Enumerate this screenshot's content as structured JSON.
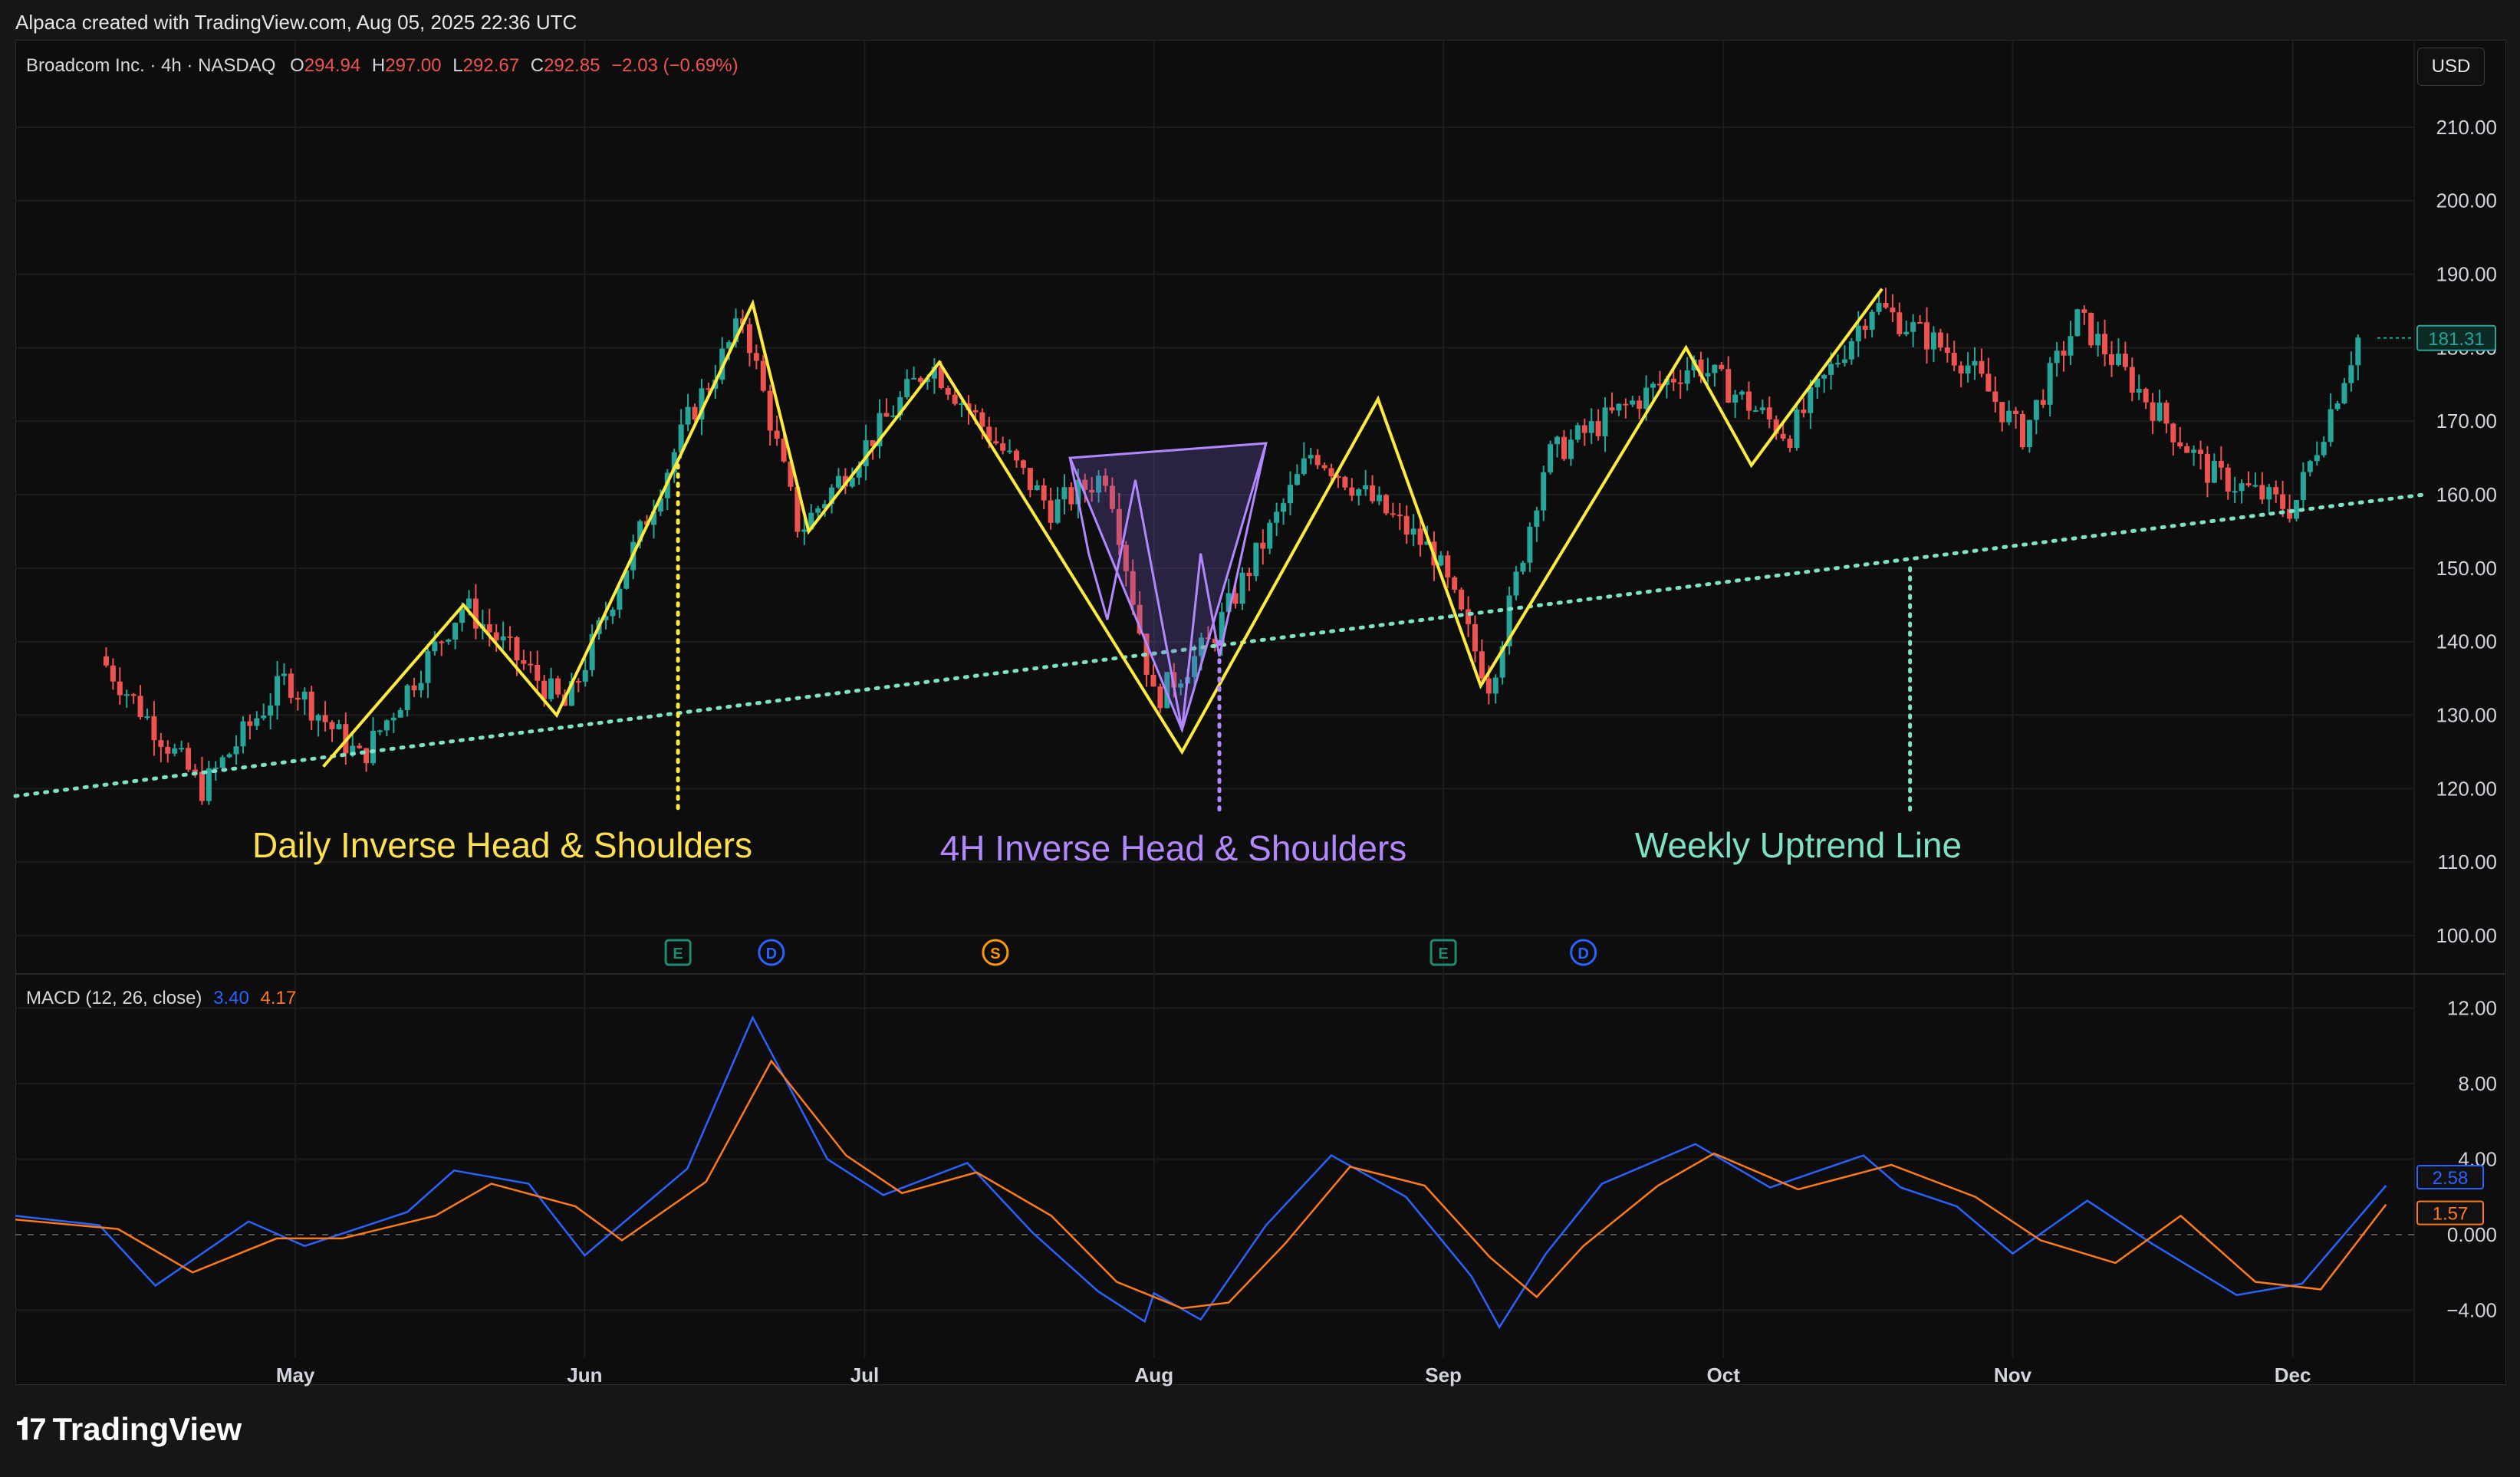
{
  "header": {
    "created_by": "Alpaca created with TradingView.com, Aug 05, 2025 22:36 UTC"
  },
  "legend": {
    "symbol": "Broadcom Inc. · 4h · NASDAQ",
    "o_label": "O",
    "o_value": "294.94",
    "h_label": "H",
    "h_value": "297.00",
    "l_label": "L",
    "l_value": "292.67",
    "c_label": "C",
    "c_value": "292.85",
    "change": "−2.03 (−0.69%)"
  },
  "currency_button": "USD",
  "macd_legend": {
    "label": "MACD (12, 26, close)",
    "macd_value": "3.40",
    "signal_value": "4.17"
  },
  "annotations": {
    "daily": "Daily Inverse Head & Shoulders",
    "fourh": "4H Inverse Head & Shoulders",
    "weekly": "Weekly Uptrend Line"
  },
  "event_markers": [
    {
      "letter": "E",
      "color": "#1f8a70"
    },
    {
      "letter": "D",
      "color": "#2962ff"
    },
    {
      "letter": "S",
      "color": "#ff9800"
    },
    {
      "letter": "E",
      "color": "#1f8a70"
    },
    {
      "letter": "D",
      "color": "#2962ff"
    }
  ],
  "brand": "TradingView",
  "colors": {
    "up": "#26a69a",
    "down": "#ef5350",
    "macd": "#2962ff",
    "signal": "#ff7a1a",
    "yellow": "#ffeb3b",
    "purple": "#b388ff",
    "trend": "#7ee0c4"
  },
  "chart_data": [
    {
      "type": "candlestick",
      "title": "",
      "x_ticks": [
        "May",
        "Jun",
        "Jul",
        "Aug",
        "Sep",
        "Oct",
        "Nov",
        "Dec"
      ],
      "y_ticks": [
        "100.00",
        "110.00",
        "120.00",
        "130.00",
        "140.00",
        "150.00",
        "160.00",
        "170.00",
        "180.00",
        "190.00",
        "200.00",
        "210.00"
      ],
      "ylim": [
        95,
        220
      ],
      "last_price_label": "181.31",
      "last_price": 181.31,
      "price_path": [
        {
          "x": "Apr 10",
          "y": 138
        },
        {
          "x": "Apr 21",
          "y": 120
        },
        {
          "x": "Apr 30",
          "y": 135
        },
        {
          "x": "May 8",
          "y": 124
        },
        {
          "x": "May 19",
          "y": 145
        },
        {
          "x": "May 30",
          "y": 131
        },
        {
          "x": "Jun 12",
          "y": 170
        },
        {
          "x": "Jun 18",
          "y": 184
        },
        {
          "x": "Jun 24",
          "y": 155
        },
        {
          "x": "Jul 8",
          "y": 178
        },
        {
          "x": "Jul 21",
          "y": 158
        },
        {
          "x": "Jul 27",
          "y": 163
        },
        {
          "x": "Aug 1",
          "y": 132
        },
        {
          "x": "Aug 7",
          "y": 140
        },
        {
          "x": "Aug 18",
          "y": 166
        },
        {
          "x": "Aug 31",
          "y": 152
        },
        {
          "x": "Sep 6",
          "y": 134
        },
        {
          "x": "Sep 12",
          "y": 165
        },
        {
          "x": "Sep 28",
          "y": 178
        },
        {
          "x": "Oct 8",
          "y": 168
        },
        {
          "x": "Oct 17",
          "y": 186
        },
        {
          "x": "Oct 27",
          "y": 178
        },
        {
          "x": "Nov 2",
          "y": 168
        },
        {
          "x": "Nov 8",
          "y": 184
        },
        {
          "x": "Nov 22",
          "y": 163
        },
        {
          "x": "Dec 1",
          "y": 158
        },
        {
          "x": "Dec 8",
          "y": 181.31
        }
      ],
      "overlays": {
        "daily_ihs": [
          {
            "x": "May 4",
            "y": 123
          },
          {
            "x": "May 19",
            "y": 145
          },
          {
            "x": "May 29",
            "y": 130
          },
          {
            "x": "Jun 19",
            "y": 186
          },
          {
            "x": "Jun 25",
            "y": 155
          },
          {
            "x": "Jul 9",
            "y": 178
          },
          {
            "x": "Aug 4",
            "y": 125
          },
          {
            "x": "Aug 25",
            "y": 173
          },
          {
            "x": "Sep 5",
            "y": 134
          },
          {
            "x": "Sep 27",
            "y": 180
          },
          {
            "x": "Oct 4",
            "y": 164
          },
          {
            "x": "Oct 18",
            "y": 188
          }
        ],
        "fourh_ihs": [
          {
            "x": "Jul 23",
            "y": 165
          },
          {
            "x": "Jul 25",
            "y": 152
          },
          {
            "x": "Jul 27",
            "y": 143
          },
          {
            "x": "Jul 30",
            "y": 162
          },
          {
            "x": "Aug 4",
            "y": 128
          },
          {
            "x": "Aug 6",
            "y": 152
          },
          {
            "x": "Aug 8",
            "y": 138
          },
          {
            "x": "Aug 13",
            "y": 167
          }
        ],
        "trendline": [
          {
            "x": "Apr 1",
            "y": 119
          },
          {
            "x": "Dec 15",
            "y": 160
          }
        ],
        "vertical_marker_x": [
          "Jun 11",
          "Aug 8",
          "Oct 21"
        ]
      }
    },
    {
      "type": "line",
      "title": "",
      "x_ticks": [
        "May",
        "Jun",
        "Jul",
        "Aug",
        "Sep",
        "Oct",
        "Nov",
        "Dec"
      ],
      "y_ticks": [
        "12.00",
        "8.00",
        "4.00",
        "0.000",
        "−4.00"
      ],
      "ylim": [
        -6.5,
        13
      ],
      "series": [
        {
          "name": "MACD",
          "last_label": "2.58",
          "points": [
            {
              "x": "Apr 1",
              "y": 1.0
            },
            {
              "x": "Apr 10",
              "y": 0.5
            },
            {
              "x": "Apr 16",
              "y": -2.7
            },
            {
              "x": "Apr 26",
              "y": 0.7
            },
            {
              "x": "May 2",
              "y": -0.6
            },
            {
              "x": "May 13",
              "y": 1.2
            },
            {
              "x": "May 18",
              "y": 3.4
            },
            {
              "x": "May 26",
              "y": 2.7
            },
            {
              "x": "Jun 1",
              "y": -1.1
            },
            {
              "x": "Jun 12",
              "y": 3.5
            },
            {
              "x": "Jun 19",
              "y": 11.5
            },
            {
              "x": "Jun 27",
              "y": 4.0
            },
            {
              "x": "Jul 3",
              "y": 2.1
            },
            {
              "x": "Jul 12",
              "y": 3.8
            },
            {
              "x": "Jul 19",
              "y": 0.1
            },
            {
              "x": "Jul 26",
              "y": -3.0
            },
            {
              "x": "Jul 31",
              "y": -4.6
            },
            {
              "x": "Aug 1",
              "y": -3.1
            },
            {
              "x": "Aug 6",
              "y": -4.5
            },
            {
              "x": "Aug 13",
              "y": 0.5
            },
            {
              "x": "Aug 20",
              "y": 4.2
            },
            {
              "x": "Aug 28",
              "y": 2.0
            },
            {
              "x": "Sep 4",
              "y": -2.2
            },
            {
              "x": "Sep 7",
              "y": -4.9
            },
            {
              "x": "Sep 12",
              "y": -1.0
            },
            {
              "x": "Sep 18",
              "y": 2.7
            },
            {
              "x": "Sep 28",
              "y": 4.8
            },
            {
              "x": "Oct 6",
              "y": 2.5
            },
            {
              "x": "Oct 16",
              "y": 4.2
            },
            {
              "x": "Oct 20",
              "y": 2.5
            },
            {
              "x": "Oct 26",
              "y": 1.5
            },
            {
              "x": "Nov 1",
              "y": -1.0
            },
            {
              "x": "Nov 9",
              "y": 1.8
            },
            {
              "x": "Nov 16",
              "y": -0.5
            },
            {
              "x": "Nov 25",
              "y": -3.2
            },
            {
              "x": "Dec 2",
              "y": -2.6
            },
            {
              "x": "Dec 11",
              "y": 2.6
            }
          ]
        },
        {
          "name": "Signal",
          "last_label": "1.57",
          "points": [
            {
              "x": "Apr 1",
              "y": 0.8
            },
            {
              "x": "Apr 12",
              "y": 0.3
            },
            {
              "x": "Apr 20",
              "y": -2.0
            },
            {
              "x": "Apr 29",
              "y": -0.2
            },
            {
              "x": "May 6",
              "y": -0.2
            },
            {
              "x": "May 16",
              "y": 1.0
            },
            {
              "x": "May 22",
              "y": 2.7
            },
            {
              "x": "May 31",
              "y": 1.5
            },
            {
              "x": "Jun 5",
              "y": -0.3
            },
            {
              "x": "Jun 14",
              "y": 2.8
            },
            {
              "x": "Jun 21",
              "y": 9.2
            },
            {
              "x": "Jun 29",
              "y": 4.2
            },
            {
              "x": "Jul 5",
              "y": 2.2
            },
            {
              "x": "Jul 13",
              "y": 3.3
            },
            {
              "x": "Jul 21",
              "y": 1.0
            },
            {
              "x": "Jul 28",
              "y": -2.5
            },
            {
              "x": "Aug 4",
              "y": -3.9
            },
            {
              "x": "Aug 9",
              "y": -3.6
            },
            {
              "x": "Aug 15",
              "y": -0.5
            },
            {
              "x": "Aug 22",
              "y": 3.6
            },
            {
              "x": "Aug 30",
              "y": 2.6
            },
            {
              "x": "Sep 6",
              "y": -1.2
            },
            {
              "x": "Sep 11",
              "y": -3.3
            },
            {
              "x": "Sep 16",
              "y": -0.6
            },
            {
              "x": "Sep 24",
              "y": 2.6
            },
            {
              "x": "Sep 30",
              "y": 4.3
            },
            {
              "x": "Oct 9",
              "y": 2.4
            },
            {
              "x": "Oct 19",
              "y": 3.7
            },
            {
              "x": "Oct 28",
              "y": 2.0
            },
            {
              "x": "Nov 4",
              "y": -0.3
            },
            {
              "x": "Nov 12",
              "y": -1.5
            },
            {
              "x": "Nov 19",
              "y": 1.0
            },
            {
              "x": "Nov 27",
              "y": -2.5
            },
            {
              "x": "Dec 4",
              "y": -2.9
            },
            {
              "x": "Dec 11",
              "y": 1.6
            }
          ]
        }
      ]
    }
  ]
}
